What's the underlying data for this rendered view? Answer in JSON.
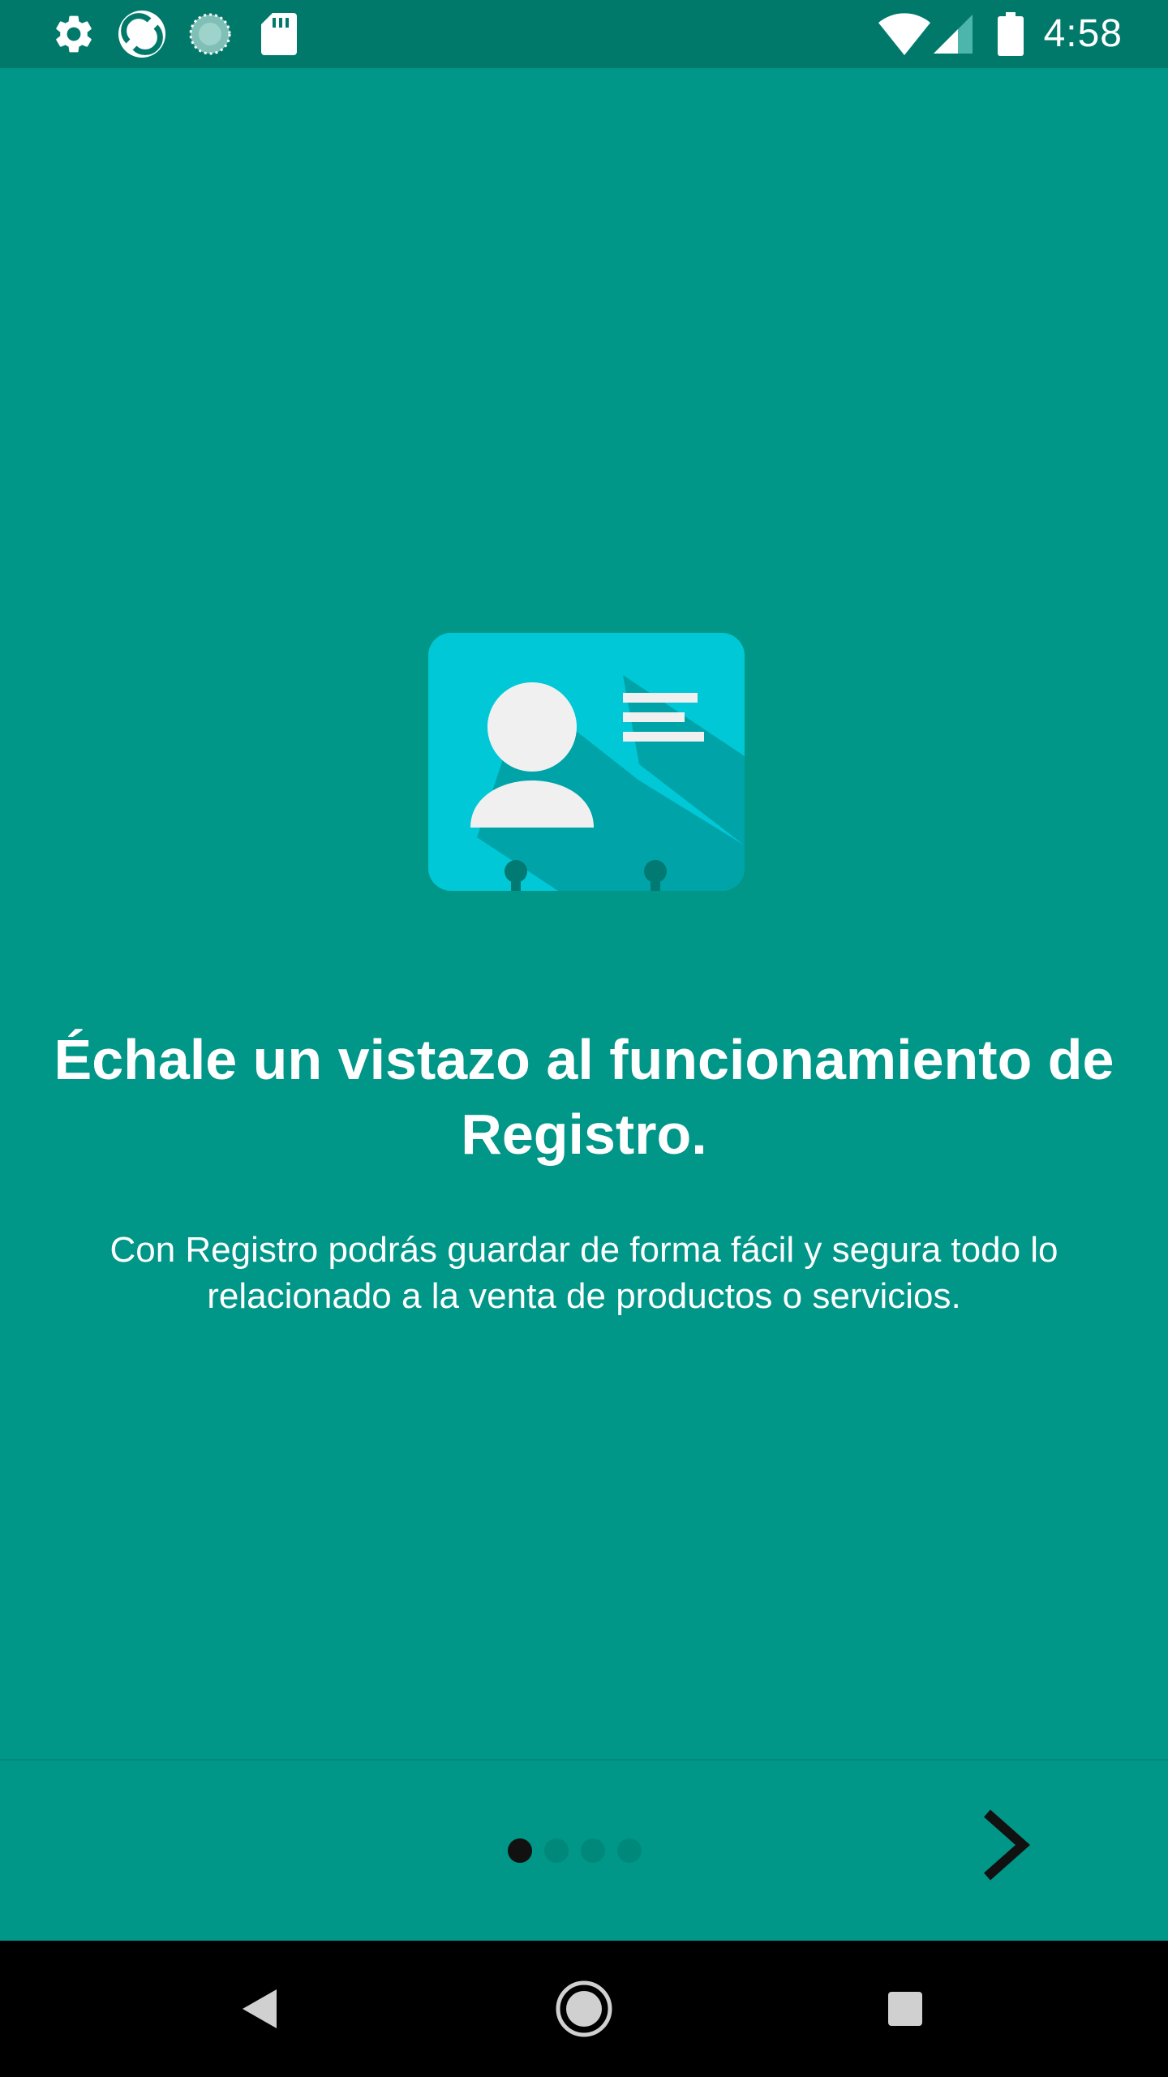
{
  "status_bar": {
    "time": "4:58",
    "left_icons": [
      "settings-gear-icon",
      "app-sync-icon",
      "loading-spinner-icon",
      "sd-card-icon"
    ],
    "right_icons": [
      "wifi-icon",
      "cellular-signal-icon",
      "battery-icon"
    ]
  },
  "onboarding": {
    "illustration": "contact-card-icon",
    "title": "Échale un vistazo al funcionamiento de Registro.",
    "description": "Con Registro podrás guardar de forma fácil y segura todo lo relacionado a la venta de productos o servicios."
  },
  "pager": {
    "page_count": 4,
    "active_page": 1
  },
  "navigation": {
    "next_icon": "chevron-right-icon"
  },
  "system_nav": {
    "buttons": [
      "back-icon",
      "home-icon",
      "recents-icon"
    ]
  },
  "colors": {
    "background": "#009688",
    "status_bar": "#00796B",
    "card": "#00C8D7",
    "card_shadow": "#00A3A8",
    "inactive_dot": "#00897B",
    "active_dot": "#111111"
  }
}
